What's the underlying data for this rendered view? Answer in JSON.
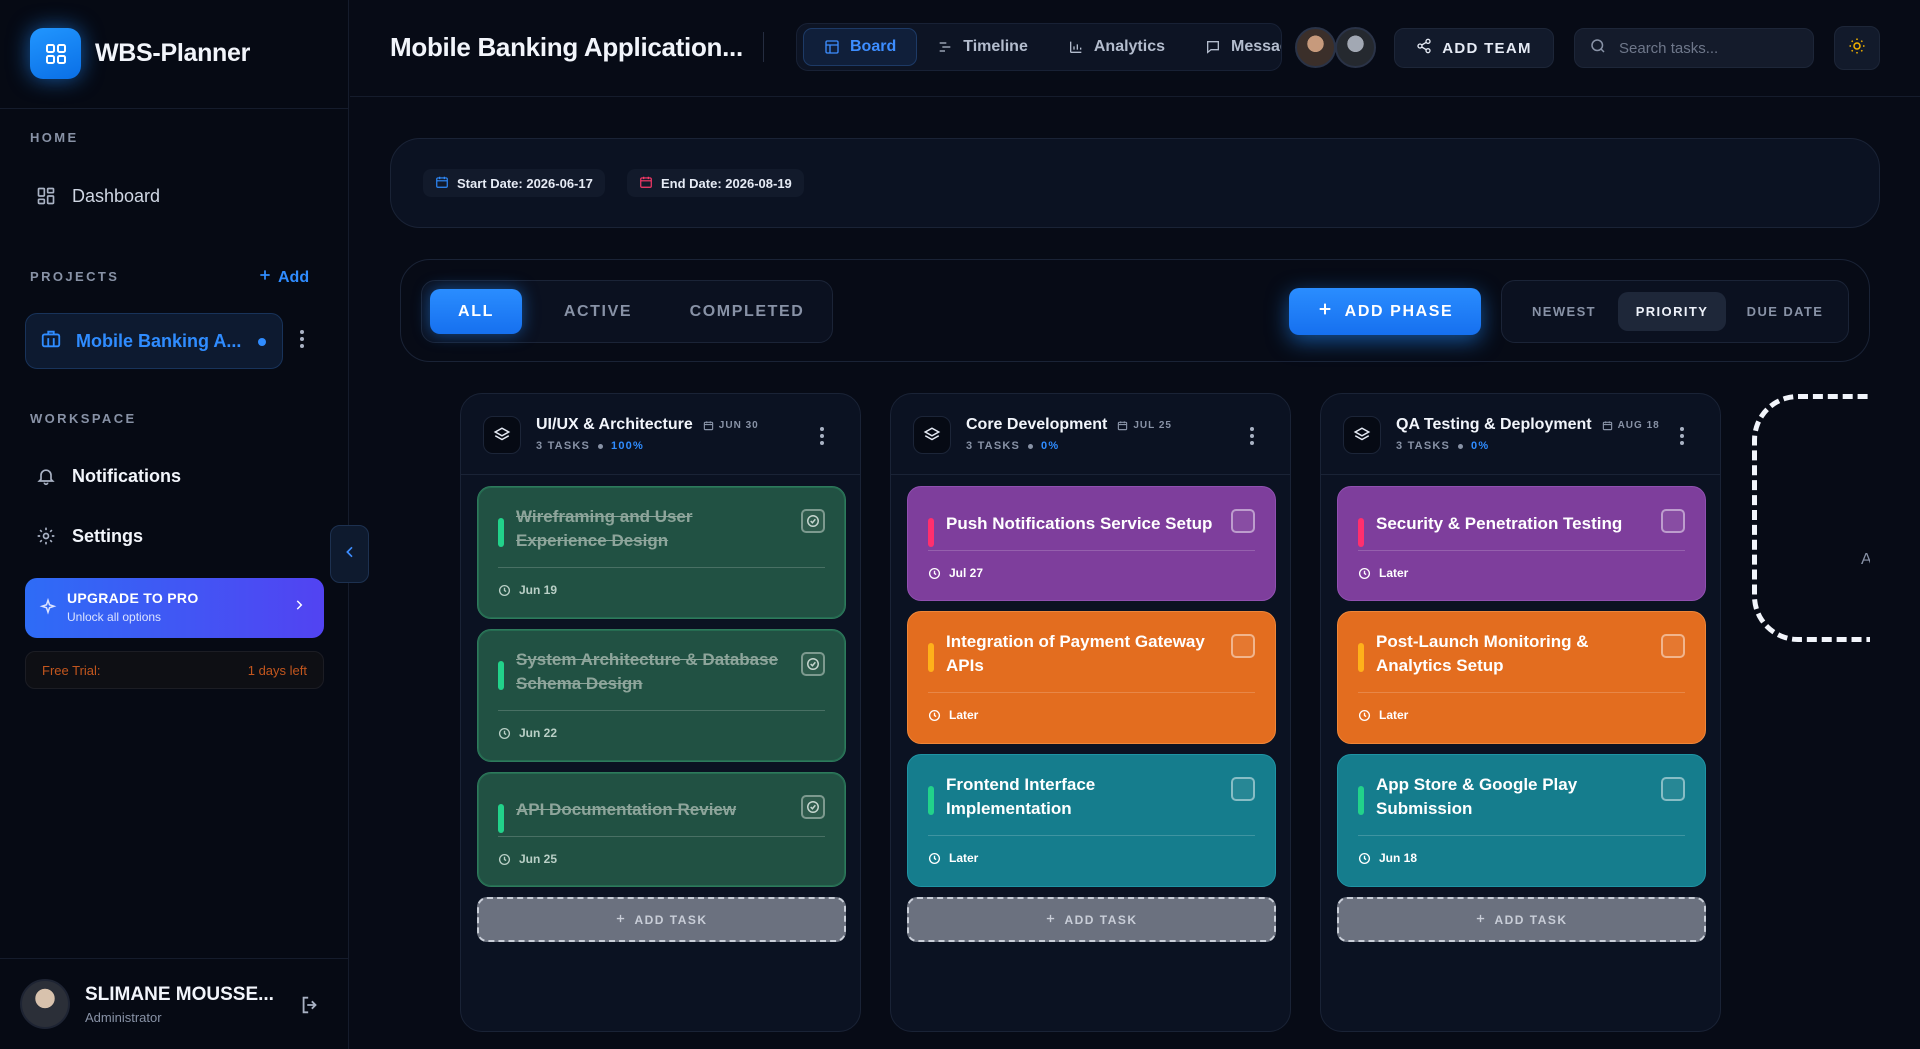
{
  "app": {
    "name": "WBS-Planner"
  },
  "sidebar": {
    "home_label": "HOME",
    "dashboard_label": "Dashboard",
    "projects_label": "PROJECTS",
    "add_label": "Add",
    "active_project": "Mobile Banking A...",
    "workspace_label": "WORKSPACE",
    "notifications_label": "Notifications",
    "settings_label": "Settings",
    "upgrade": {
      "title": "UPGRADE TO PRO",
      "subtitle": "Unlock all options"
    },
    "trial": {
      "label": "Free Trial:",
      "remaining": "1 days left"
    },
    "user": {
      "name": "SLIMANE MOUSSE...",
      "role": "Administrator"
    }
  },
  "header": {
    "title": "Mobile Banking Application...",
    "tabs": [
      {
        "label": "Board",
        "icon": "board-icon",
        "active": true
      },
      {
        "label": "Timeline",
        "icon": "timeline-icon",
        "active": false
      },
      {
        "label": "Analytics",
        "icon": "analytics-icon",
        "active": false
      },
      {
        "label": "Messages",
        "icon": "message-icon",
        "active": false
      }
    ],
    "add_team_label": "ADD TEAM",
    "search_placeholder": "Search tasks..."
  },
  "dates": {
    "start": "Start Date: 2026-06-17",
    "end": "End Date: 2026-08-19"
  },
  "filters": {
    "all": "ALL",
    "active": "ACTIVE",
    "completed": "COMPLETED",
    "selected": "ALL"
  },
  "add_phase_label": "ADD PHASE",
  "sort": {
    "newest": "NEWEST",
    "priority": "PRIORITY",
    "due_date": "DUE DATE",
    "selected": "PRIORITY"
  },
  "add_task_label": "ADD TASK",
  "ghost_column_text": "A",
  "colors": {
    "accent": "#2f8cff",
    "done_card": "#215143",
    "purple_card": "#7e3e9c",
    "orange_card": "#e36d1f",
    "teal_card": "#157d8d",
    "priority_high": "#ff2f6d",
    "priority_medium": "#ffb11a",
    "priority_low": "#22d28a"
  },
  "phases": [
    {
      "title": "UI/UX & Architecture",
      "date": "JUN 30",
      "tasks_count": "3 TASKS",
      "progress": "100%",
      "tasks": [
        {
          "title": "Wireframing and User Experience Design",
          "due": "Jun 19",
          "status": "done"
        },
        {
          "title": "System Architecture & Database Schema Design",
          "due": "Jun 22",
          "status": "done"
        },
        {
          "title": "API Documentation Review",
          "due": "Jun 25",
          "status": "done"
        }
      ]
    },
    {
      "title": "Core Development",
      "date": "JUL 25",
      "tasks_count": "3 TASKS",
      "progress": "0%",
      "tasks": [
        {
          "title": "Push Notifications Service Setup",
          "due": "Jul 27",
          "status": "open"
        },
        {
          "title": "Integration of Payment Gateway APIs",
          "due": "Later",
          "status": "open"
        },
        {
          "title": "Frontend Interface Implementation",
          "due": "Later",
          "status": "open"
        }
      ]
    },
    {
      "title": "QA Testing & Deployment",
      "date": "AUG 18",
      "tasks_count": "3 TASKS",
      "progress": "0%",
      "tasks": [
        {
          "title": "Security & Penetration Testing",
          "due": "Later",
          "status": "open"
        },
        {
          "title": "Post-Launch Monitoring & Analytics Setup",
          "due": "Later",
          "status": "open"
        },
        {
          "title": "App Store & Google Play Submission",
          "due": "Jun 18",
          "status": "open"
        }
      ]
    }
  ]
}
